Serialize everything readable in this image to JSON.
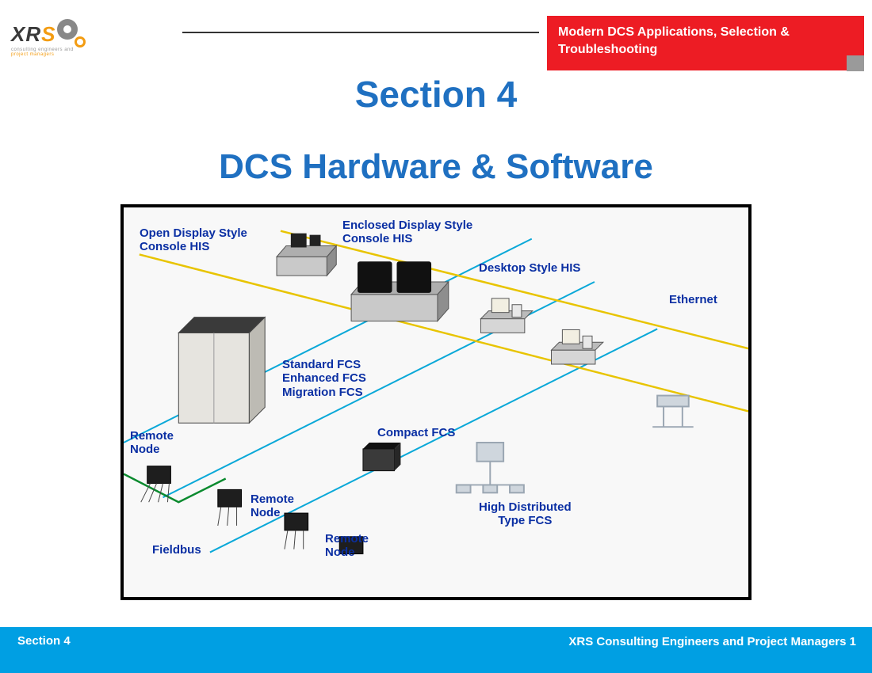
{
  "header": {
    "logo_line1": "consulting engineers and",
    "logo_line2": "project managers",
    "banner": "Modern DCS Applications, Selection & Troubleshooting"
  },
  "titles": {
    "section": "Section 4",
    "subtitle": "DCS Hardware & Software"
  },
  "diagram": {
    "open_display": "Open Display Style\nConsole HIS",
    "enclosed_display": "Enclosed Display Style\nConsole HIS",
    "desktop_his": "Desktop Style HIS",
    "ethernet": "Ethernet",
    "std_fcs": "Standard FCS\nEnhanced FCS\nMigration FCS",
    "compact_fcs": "Compact FCS",
    "high_dist": "High Distributed\nType FCS",
    "remote_node": "Remote\nNode",
    "fieldbus": "Fieldbus"
  },
  "footer": {
    "left": "Section 4",
    "right": "XRS Consulting Engineers and Project\nManagers  1"
  }
}
